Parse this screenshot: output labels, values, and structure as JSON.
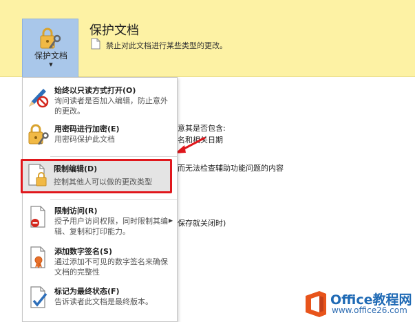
{
  "banner": {
    "button_label": "保护文档",
    "title": "保护文档",
    "description": "禁止对此文档进行某些类型的更改。"
  },
  "background_text": [
    "意其是否包含:",
    "名和相关日期",
    "而无法检查辅助功能问题的内容",
    "保存就关闭时)"
  ],
  "menu": {
    "items": [
      {
        "title": "始终以只读方式打开(O)",
        "desc": "询问读者是否加入编辑，防止意外的更改。"
      },
      {
        "title": "用密码进行加密(E)",
        "desc": "用密码保护此文档"
      },
      {
        "title": "限制编辑(D)",
        "desc": "控制其他人可以做的更改类型"
      },
      {
        "title": "限制访问(R)",
        "desc": "授予用户访问权限，同时限制其编辑、复制和打印能力。"
      },
      {
        "title": "添加数字签名(S)",
        "desc": "通过添加不可见的数字签名来确保文档的完整性"
      },
      {
        "title": "标记为最终状态(F)",
        "desc": "告诉读者此文档是最终版本。"
      }
    ]
  },
  "watermark": {
    "name": "Office教程网",
    "url": "www.office26.com"
  },
  "colors": {
    "banner": "#fdf2a4",
    "button": "#a9c7ea",
    "highlight": "#e0171c",
    "brand": "#1f6ab5",
    "brand_orange": "#e8541b"
  }
}
